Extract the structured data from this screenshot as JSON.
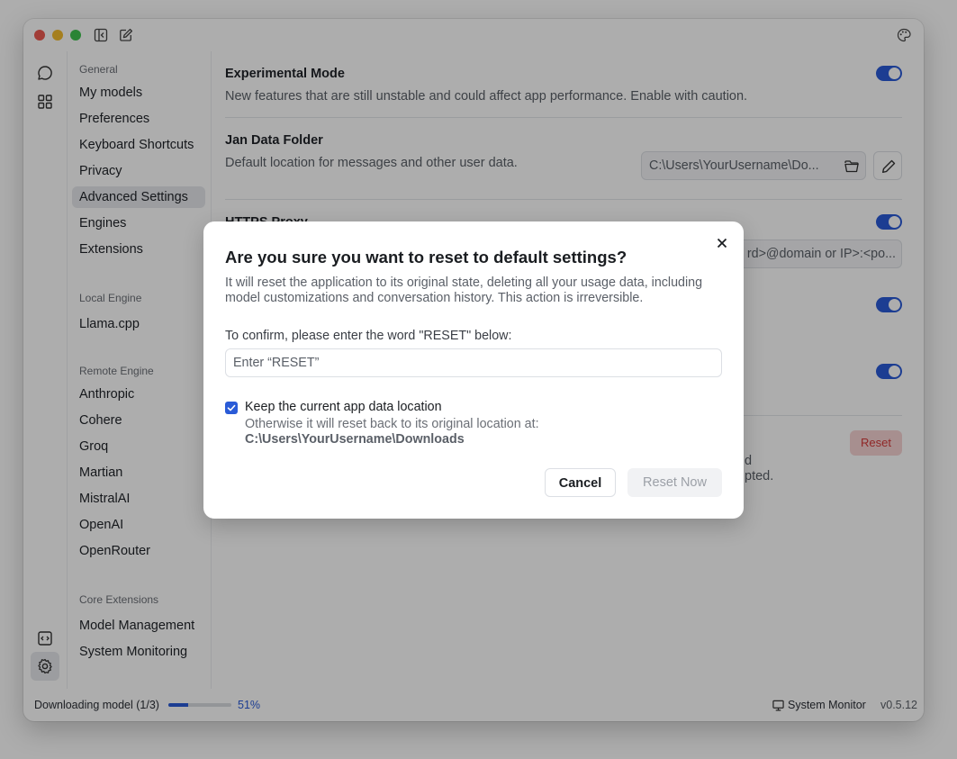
{
  "sidebar": {
    "groups": [
      {
        "title": "General",
        "items": [
          "My models",
          "Preferences",
          "Keyboard Shortcuts",
          "Privacy",
          "Advanced Settings",
          "Engines",
          "Extensions"
        ]
      },
      {
        "title": "Local Engine",
        "items": [
          "Llama.cpp"
        ]
      },
      {
        "title": "Remote Engine",
        "items": [
          "Anthropic",
          "Cohere",
          "Groq",
          "Martian",
          "MistralAI",
          "OpenAI",
          "OpenRouter"
        ]
      },
      {
        "title": "Core Extensions",
        "items": [
          "Model Management",
          "System Monitoring"
        ]
      }
    ],
    "active_item": "Advanced Settings"
  },
  "settings": {
    "experimental": {
      "title": "Experimental Mode",
      "desc": "New features that are still unstable and could affect app performance. Enable with caution.",
      "enabled": true
    },
    "data_folder": {
      "title": "Jan Data Folder",
      "desc": "Default location for messages and other user data.",
      "path": "C:\\Users\\YourUsername\\Do..."
    },
    "https_proxy": {
      "title": "HTTPS Proxy",
      "value": "rd>@domain or IP>:<po...",
      "enabled": true
    },
    "row4_toggle": true,
    "row5_toggle": true,
    "reset": {
      "button_label": "Reset",
      "desc_line1": "d",
      "desc_line2": "pted."
    }
  },
  "status_bar": {
    "download_text": "Downloading model (1/3)",
    "progress_percent": 51,
    "progress_label": "51%",
    "system_monitor": "System Monitor",
    "version": "v0.5.12"
  },
  "modal": {
    "title": "Are you sure you want to reset to default settings?",
    "description": "It will reset the application to its original state, deleting all your usage data, including model customizations and conversation history. This action is irreversible.",
    "confirm_label": "To confirm, please enter the word \"RESET\" below:",
    "input_placeholder": "Enter “RESET”",
    "input_value": "",
    "checkbox_label": "Keep the current app data location",
    "checkbox_checked": true,
    "checkbox_sub": "Otherwise it will reset back to its original location at:",
    "checkbox_path": "C:\\Users\\YourUsername\\Downloads",
    "cancel_label": "Cancel",
    "reset_now_label": "Reset Now"
  },
  "colors": {
    "accent": "#2a5bd7",
    "reset_bg": "#f6d3d3",
    "reset_text": "#d53a3a"
  },
  "icons": [
    "chat-icon",
    "grid-icon",
    "panel-collapse-icon",
    "edit-icon",
    "palette-icon",
    "code-icon",
    "settings-icon",
    "folder-icon",
    "pencil-icon",
    "close-icon",
    "monitor-icon"
  ]
}
